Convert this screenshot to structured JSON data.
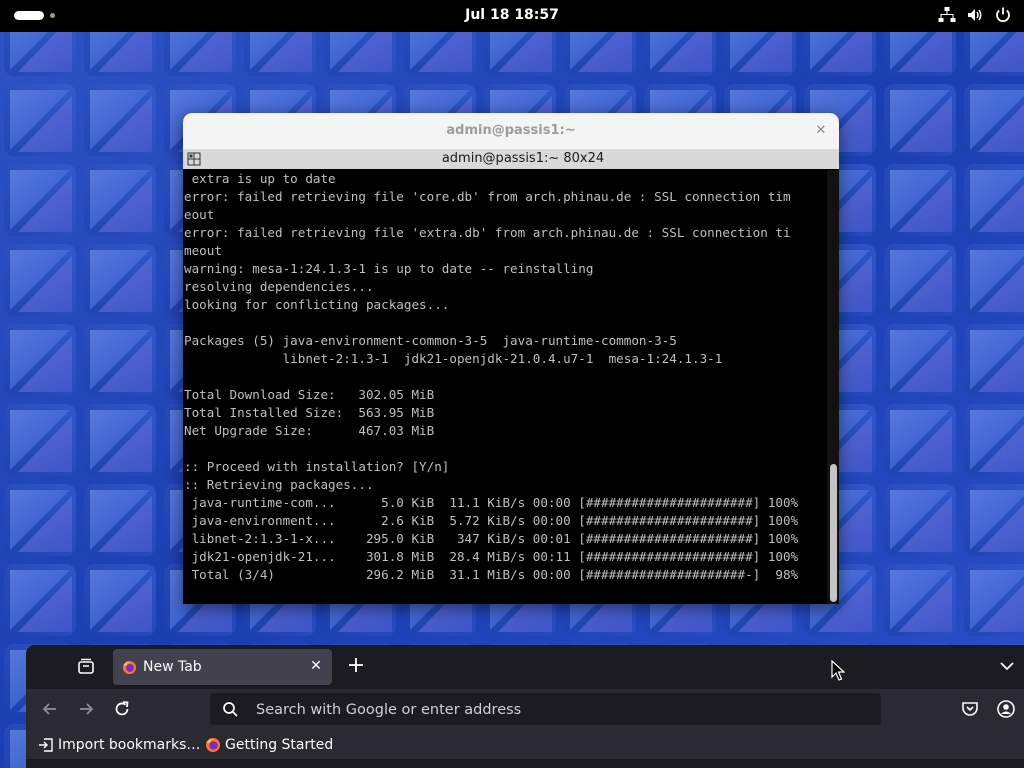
{
  "topbar": {
    "clock": "Jul 18  18:57",
    "icons": [
      "network-icon",
      "volume-icon",
      "power-icon"
    ]
  },
  "terminal": {
    "window_title": "admin@passis1:~",
    "tab_title": "admin@passis1:~ 80x24",
    "lines": [
      " extra is up to date",
      "error: failed retrieving file 'core.db' from arch.phinau.de : SSL connection tim",
      "eout",
      "error: failed retrieving file 'extra.db' from arch.phinau.de : SSL connection ti",
      "meout",
      "warning: mesa-1:24.1.3-1 is up to date -- reinstalling",
      "resolving dependencies...",
      "looking for conflicting packages...",
      "",
      "Packages (5) java-environment-common-3-5  java-runtime-common-3-5",
      "             libnet-2:1.3-1  jdk21-openjdk-21.0.4.u7-1  mesa-1:24.1.3-1",
      "",
      "Total Download Size:   302.05 MiB",
      "Total Installed Size:  563.95 MiB",
      "Net Upgrade Size:      467.03 MiB",
      "",
      ":: Proceed with installation? [Y/n]",
      ":: Retrieving packages...",
      " java-runtime-com...      5.0 KiB  11.1 KiB/s 00:00 [######################] 100%",
      " java-environment...      2.6 KiB  5.72 KiB/s 00:00 [######################] 100%",
      " libnet-2:1.3-1-x...    295.0 KiB   347 KiB/s 00:01 [######################] 100%",
      " jdk21-openjdk-21...    301.8 MiB  28.4 MiB/s 00:11 [######################] 100%",
      " Total (3/4)            296.2 MiB  31.1 MiB/s 00:00 [#####################-]  98%",
      ""
    ]
  },
  "firefox": {
    "tab_title": "New Tab",
    "search_placeholder": "Search with Google or enter address",
    "bookmarks": [
      {
        "label": "Import bookmarks…",
        "icon": "import-icon"
      },
      {
        "label": "Getting Started",
        "icon": "firefox-icon"
      }
    ]
  },
  "colors": {
    "wallpaper_blue": "#1c44b8",
    "terminal_bg": "#000000",
    "terminal_text": "#bfbfbf",
    "firefox_dark": "#2b2a33"
  }
}
